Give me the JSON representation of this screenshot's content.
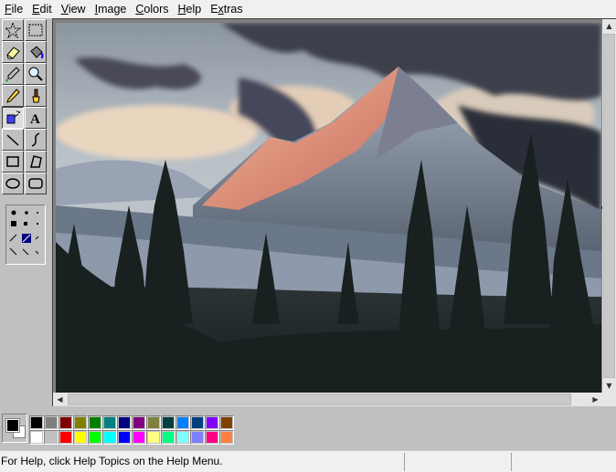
{
  "menu": [
    {
      "label": "File",
      "accel": "F",
      "rest": "ile"
    },
    {
      "label": "Edit",
      "accel": "E",
      "rest": "dit"
    },
    {
      "label": "View",
      "accel": "V",
      "rest": "iew"
    },
    {
      "label": "Image",
      "accel": "I",
      "rest": "mage"
    },
    {
      "label": "Colors",
      "accel": "C",
      "rest": "olors"
    },
    {
      "label": "Help",
      "accel": "H",
      "rest": "elp"
    },
    {
      "label": "Extras",
      "accel": "x",
      "pre": "E",
      "rest": "tras"
    }
  ],
  "tools": [
    {
      "name": "free-form-select-tool",
      "icon": "star-select-icon"
    },
    {
      "name": "rect-select-tool",
      "icon": "rect-select-icon"
    },
    {
      "name": "eraser-tool",
      "icon": "eraser-icon"
    },
    {
      "name": "fill-tool",
      "icon": "paint-bucket-icon"
    },
    {
      "name": "pick-color-tool",
      "icon": "eyedropper-icon"
    },
    {
      "name": "magnifier-tool",
      "icon": "magnifier-icon"
    },
    {
      "name": "pencil-tool",
      "icon": "pencil-icon"
    },
    {
      "name": "brush-tool",
      "icon": "brush-icon"
    },
    {
      "name": "airbrush-tool",
      "icon": "airbrush-icon"
    },
    {
      "name": "text-tool",
      "icon": "text-a-icon"
    },
    {
      "name": "line-tool",
      "icon": "line-icon"
    },
    {
      "name": "curve-tool",
      "icon": "curve-icon"
    },
    {
      "name": "rectangle-tool",
      "icon": "rectangle-icon"
    },
    {
      "name": "polygon-tool",
      "icon": "polygon-icon"
    },
    {
      "name": "ellipse-tool",
      "icon": "ellipse-icon"
    },
    {
      "name": "rounded-rectangle-tool",
      "icon": "rounded-rect-icon"
    }
  ],
  "selected_tool": "airbrush-tool",
  "palette": {
    "foreground": "#000000",
    "background": "#ffffff",
    "row1": [
      "#000000",
      "#808080",
      "#800000",
      "#808000",
      "#008000",
      "#008080",
      "#000080",
      "#800080",
      "#808040",
      "#004040",
      "#0080ff",
      "#004080",
      "#8000ff",
      "#804000"
    ],
    "row2": [
      "#ffffff",
      "#c0c0c0",
      "#ff0000",
      "#ffff00",
      "#00ff00",
      "#00ffff",
      "#0000ff",
      "#ff00ff",
      "#ffff80",
      "#00ff80",
      "#80ffff",
      "#8080ff",
      "#ff0080",
      "#ff8040"
    ]
  },
  "status": {
    "help_text": "For Help, click Help Topics on the Help Menu."
  },
  "canvas": {
    "picture": "mountain-landscape-painting",
    "colors": {
      "sky": "#b8bfc4",
      "cloud_dark": "#3e3f4a",
      "cloud_light": "#e8d2b8",
      "peak_lit": "#e4a58e",
      "slope_snow": "#8f9cae",
      "forest": "#1c2424"
    }
  }
}
